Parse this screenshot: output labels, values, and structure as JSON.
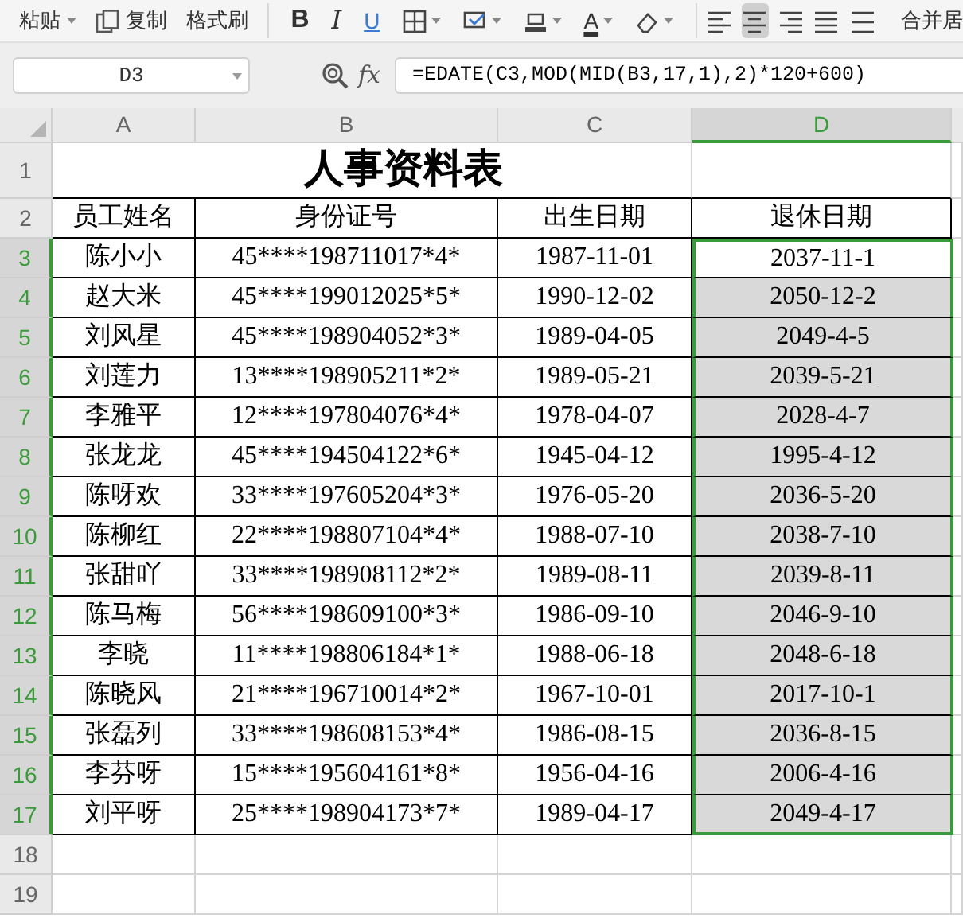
{
  "toolbar": {
    "clipboard": [
      {
        "kind": "paste",
        "label": "粘贴"
      },
      {
        "kind": "copy",
        "label": "复制"
      },
      {
        "kind": "brush",
        "label": "格式刷"
      }
    ],
    "font": [
      {
        "kind": "bold",
        "glyph": "B"
      },
      {
        "kind": "italic",
        "glyph": "I"
      },
      {
        "kind": "underline",
        "glyph": "U"
      },
      {
        "kind": "borders"
      },
      {
        "kind": "cell-fill"
      },
      {
        "kind": "highlight"
      },
      {
        "kind": "font-color",
        "glyph": "A"
      },
      {
        "kind": "eraser"
      }
    ],
    "align": [
      {
        "kind": "left",
        "selected": false
      },
      {
        "kind": "center",
        "selected": true
      },
      {
        "kind": "right",
        "selected": false
      },
      {
        "kind": "justify",
        "selected": false
      },
      {
        "kind": "distributed",
        "selected": false
      }
    ],
    "merge_label": "合并居"
  },
  "name_box": "D3",
  "fx": "fx",
  "formula": "=EDATE(C3,MOD(MID(B3,17,1),2)*120+600)",
  "columns": [
    {
      "label": "A",
      "selected": false
    },
    {
      "label": "B",
      "selected": false
    },
    {
      "label": "C",
      "selected": false
    },
    {
      "label": "D",
      "selected": true
    }
  ],
  "title_row": {
    "number": "1",
    "title": "人事资料表"
  },
  "header_row": {
    "number": "2",
    "cells": [
      "员工姓名",
      "身份证号",
      "出生日期",
      "退休日期"
    ]
  },
  "rows": [
    {
      "number": "3",
      "selected": true,
      "active": true,
      "cells": [
        "陈小小",
        "45****198711017*4*",
        "1987-11-01",
        "2037-11-1"
      ]
    },
    {
      "number": "4",
      "selected": true,
      "active": false,
      "cells": [
        "赵大米",
        "45****199012025*5*",
        "1990-12-02",
        "2050-12-2"
      ]
    },
    {
      "number": "5",
      "selected": true,
      "active": false,
      "cells": [
        "刘风星",
        "45****198904052*3*",
        "1989-04-05",
        "2049-4-5"
      ]
    },
    {
      "number": "6",
      "selected": true,
      "active": false,
      "cells": [
        "刘莲力",
        "13****198905211*2*",
        "1989-05-21",
        "2039-5-21"
      ]
    },
    {
      "number": "7",
      "selected": true,
      "active": false,
      "cells": [
        "李雅平",
        "12****197804076*4*",
        "1978-04-07",
        "2028-4-7"
      ]
    },
    {
      "number": "8",
      "selected": true,
      "active": false,
      "cells": [
        "张龙龙",
        "45****194504122*6*",
        "1945-04-12",
        "1995-4-12"
      ]
    },
    {
      "number": "9",
      "selected": true,
      "active": false,
      "cells": [
        "陈呀欢",
        "33****197605204*3*",
        "1976-05-20",
        "2036-5-20"
      ]
    },
    {
      "number": "10",
      "selected": true,
      "active": false,
      "cells": [
        "陈柳红",
        "22****198807104*4*",
        "1988-07-10",
        "2038-7-10"
      ]
    },
    {
      "number": "11",
      "selected": true,
      "active": false,
      "cells": [
        "张甜吖",
        "33****198908112*2*",
        "1989-08-11",
        "2039-8-11"
      ]
    },
    {
      "number": "12",
      "selected": true,
      "active": false,
      "cells": [
        "陈马梅",
        "56****198609100*3*",
        "1986-09-10",
        "2046-9-10"
      ]
    },
    {
      "number": "13",
      "selected": true,
      "active": false,
      "cells": [
        "李晓",
        "11****198806184*1*",
        "1988-06-18",
        "2048-6-18"
      ]
    },
    {
      "number": "14",
      "selected": true,
      "active": false,
      "cells": [
        "陈晓风",
        "21****196710014*2*",
        "1967-10-01",
        "2017-10-1"
      ]
    },
    {
      "number": "15",
      "selected": true,
      "active": false,
      "cells": [
        "张磊列",
        "33****198608153*4*",
        "1986-08-15",
        "2036-8-15"
      ]
    },
    {
      "number": "16",
      "selected": true,
      "active": false,
      "cells": [
        "李芬呀",
        "15****195604161*8*",
        "1956-04-16",
        "2006-4-16"
      ]
    },
    {
      "number": "17",
      "selected": true,
      "active": false,
      "cells": [
        "刘平呀",
        "25****198904173*7*",
        "1989-04-17",
        "2049-4-17"
      ]
    }
  ],
  "empty_rows": [
    "18",
    "19"
  ]
}
